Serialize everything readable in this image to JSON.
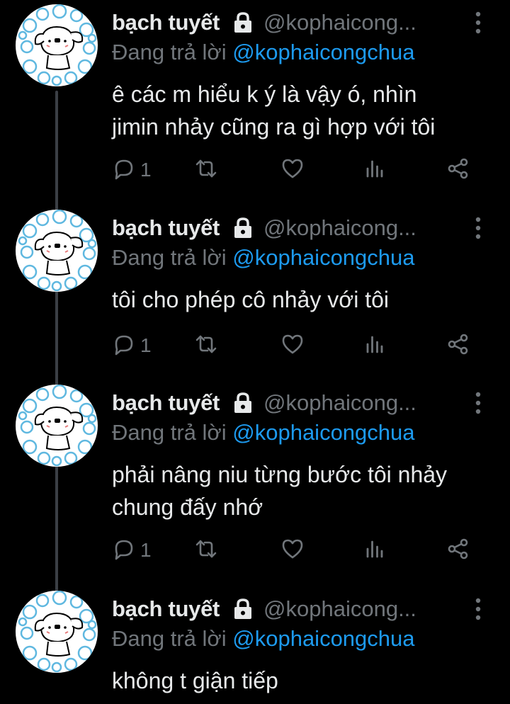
{
  "theme": {
    "background": "#000000",
    "text_primary": "#e7e9ea",
    "text_secondary": "#71767b",
    "accent": "#1d9bf0",
    "thread_line": "#3b3f45"
  },
  "tweets": [
    {
      "display_name": "bạch tuyết",
      "handle": "@kophaicong...",
      "reply_prefix": "Đang trả lời",
      "reply_to": "@kophaicongchua",
      "text_lines": [
        "ê các m hiểu k ý là vậy ó, nhìn",
        "jimin nhảy cũng ra gì hợp với tôi"
      ],
      "reply_count": "1",
      "icons": [
        "lock-icon",
        "more-icon",
        "reply-icon",
        "retweet-icon",
        "like-icon",
        "analytics-icon",
        "share-icon"
      ]
    },
    {
      "display_name": "bạch tuyết",
      "handle": "@kophaicong...",
      "reply_prefix": "Đang trả lời",
      "reply_to": "@kophaicongchua",
      "text_lines": [
        "tôi cho phép cô nhảy với tôi"
      ],
      "reply_count": "1",
      "icons": [
        "lock-icon",
        "more-icon",
        "reply-icon",
        "retweet-icon",
        "like-icon",
        "analytics-icon",
        "share-icon"
      ]
    },
    {
      "display_name": "bạch tuyết",
      "handle": "@kophaicong...",
      "reply_prefix": "Đang trả lời",
      "reply_to": "@kophaicongchua",
      "text_lines": [
        "phải nâng niu từng bước tôi nhảy",
        "chung đấy nhớ"
      ],
      "reply_count": "1",
      "icons": [
        "lock-icon",
        "more-icon",
        "reply-icon",
        "retweet-icon",
        "like-icon",
        "analytics-icon",
        "share-icon"
      ]
    },
    {
      "display_name": "bạch tuyết",
      "handle": "@kophaicong...",
      "reply_prefix": "Đang trả lời",
      "reply_to": "@kophaicongchua",
      "text_lines": [
        "không t giận tiếp"
      ],
      "icons": [
        "lock-icon",
        "more-icon"
      ]
    }
  ]
}
